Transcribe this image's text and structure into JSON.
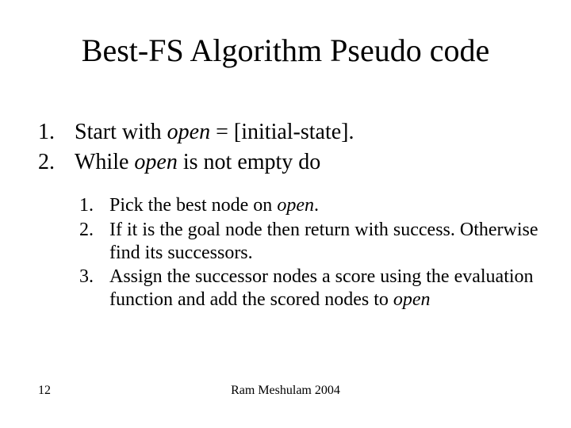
{
  "title": "Best-FS Algorithm Pseudo code",
  "outer": [
    {
      "num": "1.",
      "pre": "Start with ",
      "it": "open",
      "post": " = [initial-state]."
    },
    {
      "num": "2.",
      "pre": "While ",
      "it": "open",
      "post": " is not empty do"
    }
  ],
  "inner": [
    {
      "num": "1.",
      "pre": "Pick the best node on ",
      "it": "open",
      "post": "."
    },
    {
      "num": "2.",
      "pre": "If it is the goal node then return with success. Otherwise find its successors.",
      "it": "",
      "post": ""
    },
    {
      "num": "3.",
      "pre": "Assign the successor nodes a score using the evaluation function and add the scored nodes to ",
      "it": "open",
      "post": ""
    }
  ],
  "footer": {
    "page": "12",
    "credit": "Ram Meshulam 2004"
  }
}
